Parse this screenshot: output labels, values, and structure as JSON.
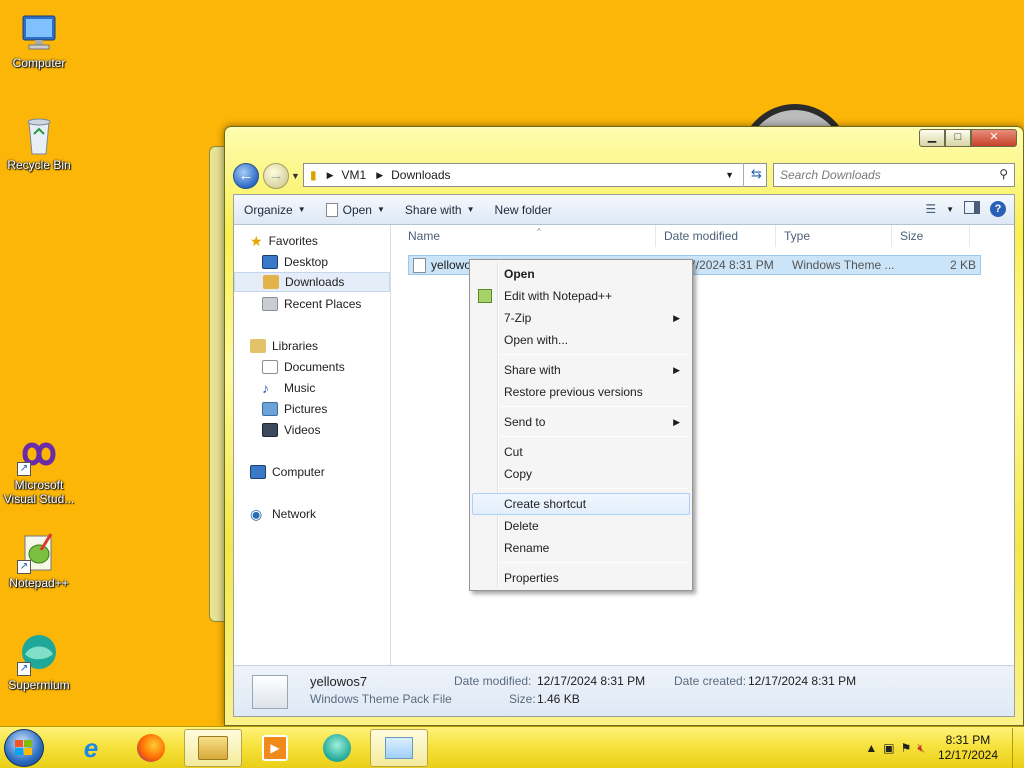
{
  "desktop": {
    "icons": [
      {
        "label": "Computer"
      },
      {
        "label": "Recycle Bin"
      },
      {
        "label": "Microsoft Visual Stud..."
      },
      {
        "label": "Notepad++"
      },
      {
        "label": "Supermium"
      }
    ]
  },
  "window": {
    "address": {
      "segments": [
        "VM1",
        "Downloads"
      ]
    },
    "search_placeholder": "Search Downloads",
    "toolbar": {
      "organize": "Organize",
      "open": "Open",
      "share_with": "Share with",
      "new_folder": "New folder"
    },
    "nav": {
      "favorites": "Favorites",
      "desktop": "Desktop",
      "downloads": "Downloads",
      "recent_places": "Recent Places",
      "libraries": "Libraries",
      "documents": "Documents",
      "music": "Music",
      "pictures": "Pictures",
      "videos": "Videos",
      "computer": "Computer",
      "network": "Network"
    },
    "columns": {
      "name": "Name",
      "date_modified": "Date modified",
      "type": "Type",
      "size": "Size"
    },
    "file": {
      "name_visible": "yellowo",
      "date_visible": "/17/2024 8:31 PM",
      "type": "Windows Theme ...",
      "size": "2 KB"
    },
    "details": {
      "name": "yellowos7",
      "type": "Windows Theme Pack File",
      "date_modified_label": "Date modified:",
      "date_modified": "12/17/2024 8:31 PM",
      "date_created_label": "Date created:",
      "date_created": "12/17/2024 8:31 PM",
      "size_label": "Size:",
      "size": "1.46 KB"
    }
  },
  "context_menu": {
    "open": "Open",
    "edit_notepad": "Edit with Notepad++",
    "seven_zip": "7-Zip",
    "open_with": "Open with...",
    "share_with": "Share with",
    "restore": "Restore previous versions",
    "send_to": "Send to",
    "cut": "Cut",
    "copy": "Copy",
    "create_shortcut": "Create shortcut",
    "delete": "Delete",
    "rename": "Rename",
    "properties": "Properties"
  },
  "taskbar": {
    "time": "8:31 PM",
    "date": "12/17/2024"
  },
  "colors": {
    "desktop_bg": "#fbb607",
    "selection": "#cce4f7",
    "accent_blue": "#2a5fb8"
  }
}
